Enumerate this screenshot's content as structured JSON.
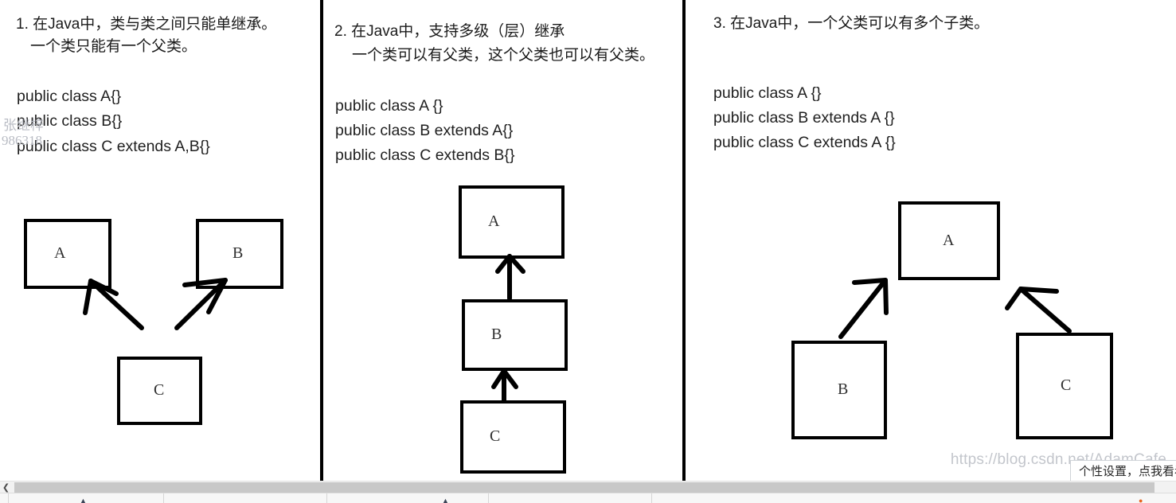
{
  "slide": {
    "panels": [
      {
        "id": "panel-1",
        "heading_line1": "1. 在Java中，类与类之间只能单继承。",
        "heading_line2": "一个类只能有一个父类。",
        "code": [
          "public class A{}",
          "public class B{}",
          "public class C extends A,B{}"
        ],
        "diagram": {
          "type": "class-inheritance",
          "boxes": [
            {
              "label": "A"
            },
            {
              "label": "B"
            },
            {
              "label": "C"
            }
          ],
          "edges": [
            {
              "from": "C",
              "to": "A"
            },
            {
              "from": "C",
              "to": "B"
            }
          ]
        }
      },
      {
        "id": "panel-2",
        "heading_line1": "2. 在Java中，支持多级（层）继承",
        "heading_line2": "一个类可以有父类，这个父类也可以有父类。",
        "code": [
          "public class A {}",
          "public class B extends A{}",
          "public class C extends B{}"
        ],
        "diagram": {
          "type": "class-inheritance",
          "boxes": [
            {
              "label": "A"
            },
            {
              "label": "B"
            },
            {
              "label": "C"
            }
          ],
          "edges": [
            {
              "from": "B",
              "to": "A"
            },
            {
              "from": "C",
              "to": "B"
            }
          ]
        }
      },
      {
        "id": "panel-3",
        "heading_line1": "3. 在Java中，一个父类可以有多个子类。",
        "heading_line2": "",
        "code": [
          "public class A {}",
          "public class B extends A {}",
          "public class C extends A {}"
        ],
        "diagram": {
          "type": "class-inheritance",
          "boxes": [
            {
              "label": "A"
            },
            {
              "label": "B"
            },
            {
              "label": "C"
            }
          ],
          "edges": [
            {
              "from": "B",
              "to": "A"
            },
            {
              "from": "C",
              "to": "A"
            }
          ]
        }
      }
    ]
  },
  "watermarks": {
    "left_line1": "张继梓",
    "left_line2": "986318",
    "url": "https://blog.csdn.net/AdamCafe"
  },
  "tooltip": {
    "text": "个性设置，点我看看"
  },
  "scrollbar": {
    "left_arrow": "❮"
  },
  "taskbar": {
    "items": [
      {
        "label": "",
        "glyph": "▲"
      },
      {
        "label": "",
        "glyph": ""
      },
      {
        "label": "",
        "glyph": "▲"
      },
      {
        "label": "",
        "glyph": ""
      },
      {
        "label": "",
        "glyph": ""
      }
    ]
  },
  "colors": {
    "ink": "#000000",
    "text": "#1b1b1b",
    "watermark": "#c3c6cc",
    "scroll_thumb": "#c8c8c8"
  }
}
